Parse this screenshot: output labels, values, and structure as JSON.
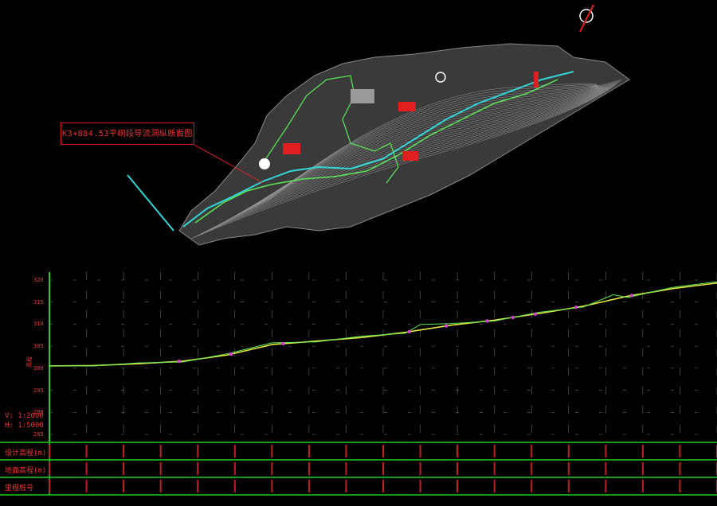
{
  "callout": {
    "text": "K3+884.53平峒段导流洞纵断面图"
  },
  "profile": {
    "y_ticks": [
      "320",
      "315",
      "310",
      "305",
      "300",
      "295",
      "290",
      "285"
    ],
    "y_axis_label": "高程",
    "scale_v": "V: 1:2000",
    "scale_h": "H: 1:5000",
    "rows": [
      {
        "label": "设计高程(m)"
      },
      {
        "label": "地面高程(m)"
      },
      {
        "label": "里程桩号"
      }
    ]
  },
  "chart_data": {
    "type": "line",
    "xlim": [
      0,
      900
    ],
    "ylim": [
      283,
      322
    ],
    "series": [
      {
        "values": [
          [
            0,
            300.5
          ],
          [
            60,
            300.6
          ],
          [
            120,
            301
          ],
          [
            180,
            301.6
          ],
          [
            240,
            303
          ],
          [
            300,
            305.4
          ],
          [
            360,
            306.2
          ],
          [
            420,
            307
          ],
          [
            480,
            308.2
          ],
          [
            540,
            309.8
          ],
          [
            600,
            311
          ],
          [
            660,
            312.5
          ],
          [
            720,
            314.2
          ],
          [
            780,
            316.5
          ],
          [
            840,
            318.2
          ],
          [
            900,
            319.5
          ]
        ]
      },
      {
        "values": [
          [
            0,
            300.5
          ],
          [
            60,
            300.5
          ],
          [
            120,
            301.2
          ],
          [
            180,
            301.4
          ],
          [
            240,
            303.3
          ],
          [
            300,
            305.8
          ],
          [
            360,
            306
          ],
          [
            420,
            307.3
          ],
          [
            480,
            308
          ],
          [
            500,
            310
          ],
          [
            540,
            310.2
          ],
          [
            600,
            310.8
          ],
          [
            660,
            312.8
          ],
          [
            720,
            314
          ],
          [
            760,
            316.8
          ],
          [
            780,
            316.2
          ],
          [
            840,
            318.5
          ],
          [
            900,
            319.8
          ]
        ]
      }
    ],
    "markers_x": [
      175,
      245,
      315,
      485,
      535,
      590,
      625,
      655,
      710,
      785
    ]
  },
  "colors": {
    "grid_green": "#22d822",
    "axis": "#1fd01f",
    "line_yellow": "#e6e63c",
    "line_green": "#5be85b",
    "red": "#e02020",
    "cyan": "#33d6d6",
    "magenta": "#d044d0"
  }
}
